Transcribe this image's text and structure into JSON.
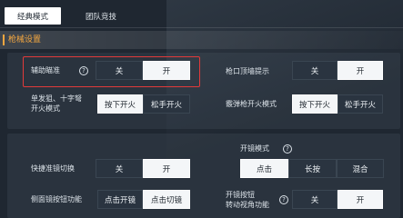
{
  "tabs": [
    {
      "label": "经典模式",
      "active": true
    },
    {
      "label": "团队竞技",
      "active": false
    }
  ],
  "section": {
    "title": "枪械设置"
  },
  "settings": {
    "aim_assist": {
      "label": "辅助瞄准",
      "help": "?",
      "options": [
        "关",
        "开"
      ],
      "selected": "开"
    },
    "muzzle_hint": {
      "label": "枪口顶墙提示",
      "options": [
        "关",
        "开"
      ],
      "selected": "开"
    },
    "sniper_fire": {
      "label_line1": "单发狙、十字弩",
      "label_line2": "开火模式",
      "options": [
        "按下开火",
        "松手开火"
      ],
      "selected": "按下开火"
    },
    "shotgun_fire": {
      "label": "霰弹枪开火模式",
      "options": [
        "按下开火",
        "松手开火"
      ],
      "selected": "按下开火"
    },
    "scope_mode": {
      "label": "开镜模式",
      "help": "?",
      "options": [
        "点击",
        "长按",
        "混合"
      ],
      "selected": "点击"
    },
    "quick_scope": {
      "label": "快捷准镜切换",
      "options": [
        "关",
        "开"
      ],
      "selected": "开"
    },
    "side_scope": {
      "label": "侧面镜按钮功能",
      "options": [
        "点击开镜",
        "点击切镜"
      ],
      "selected": "点击切镜"
    },
    "scope_turn": {
      "label_line1": "开镜按钮",
      "label_line2": "转动视角功能",
      "help": "?",
      "options": [
        "关",
        "开"
      ],
      "selected": "开"
    }
  },
  "colors": {
    "accent": "#f2a640",
    "selected_bg": "#f4f6f8",
    "highlight": "#e23a3a",
    "background": "#1f2731"
  }
}
